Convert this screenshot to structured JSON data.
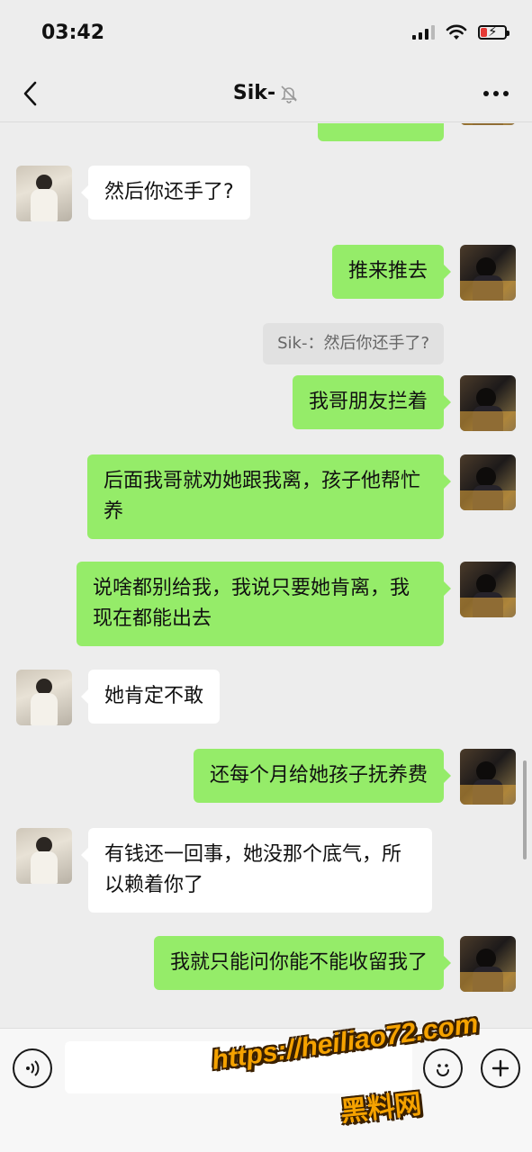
{
  "status_bar": {
    "time": "03:42"
  },
  "header": {
    "title": "Sik-"
  },
  "messages": [
    {
      "side": "out",
      "text": ""
    },
    {
      "side": "in",
      "text": "然后你还手了?"
    },
    {
      "side": "out",
      "text": "推来推去"
    },
    {
      "side": "quote",
      "text": "Sik-：然后你还手了?"
    },
    {
      "side": "out",
      "text": "我哥朋友拦着"
    },
    {
      "side": "out",
      "text": "后面我哥就劝她跟我离，孩子他帮忙养"
    },
    {
      "side": "out",
      "text": "说啥都别给我，我说只要她肯离，我现在都能出去"
    },
    {
      "side": "in",
      "text": "她肯定不敢"
    },
    {
      "side": "out",
      "text": "还每个月给她孩子抚养费"
    },
    {
      "side": "in",
      "text": "有钱还一回事，她没那个底气，所以赖着你了"
    },
    {
      "side": "out",
      "text": "我就只能问你能不能收留我了"
    }
  ],
  "input_bar": {
    "placeholder": ""
  },
  "watermark": {
    "url": "https://heiliao72.com",
    "label": "黑料网"
  },
  "colors": {
    "out_bubble": "#95ec69",
    "in_bubble": "#ffffff",
    "background": "#ededed"
  },
  "icons": [
    "back-icon",
    "mute-bell-icon",
    "more-icon",
    "voice-icon",
    "emoji-icon",
    "plus-icon",
    "battery-charging-icon",
    "wifi-icon",
    "signal-icon"
  ]
}
